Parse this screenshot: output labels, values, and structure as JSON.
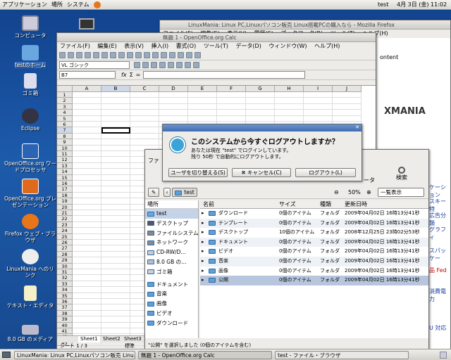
{
  "topbar": {
    "menus": [
      "アプリケーション",
      "場所",
      "システム"
    ],
    "user": "test",
    "date": "4月 3日 (金) 11:02"
  },
  "desktop_icons": [
    {
      "label": "コンピュータ",
      "name": "computer"
    },
    {
      "label": "testのホーム",
      "name": "home"
    },
    {
      "label": "ゴミ箱",
      "name": "trash"
    },
    {
      "label": "Eclipse",
      "name": "eclipse"
    },
    {
      "label": "OpenOffice.org ワードプロセッサ",
      "name": "writer"
    },
    {
      "label": "OpenOffice.org プレゼンテーション",
      "name": "impress"
    },
    {
      "label": "Firefox ウェブ・ブラウザ",
      "name": "firefox"
    },
    {
      "label": "LinuxMania へのリンク",
      "name": "linuxmania-link"
    },
    {
      "label": "テキスト・エディタ",
      "name": "text-editor"
    },
    {
      "label": "8.0 GB のメディア",
      "name": "media"
    }
  ],
  "firefox": {
    "title": "LinuxMania: Linux PC,Linuxパソコン販売 Linux搭載PCの購入なら - Mozilla Firefox",
    "menu": [
      "ファイル(F)",
      "編集(E)",
      "表示(V)",
      "履歴(S)",
      "ブックマーク(B)",
      "ツール(T)",
      "ヘルプ(H)"
    ],
    "snippets": [
      "ontent",
      "ケーション",
      "スキー特",
      "広告分類",
      "グラフィ",
      "スパッケー",
      "品 Fed",
      "消費電力",
      "U 対応"
    ]
  },
  "calc": {
    "title": "無題 1 - OpenOffice.org Calc",
    "menu": [
      "ファイル(F)",
      "編集(E)",
      "表示(V)",
      "挿入(I)",
      "書式(O)",
      "ツール(T)",
      "データ(D)",
      "ウィンドウ(W)",
      "ヘルプ(H)"
    ],
    "font": "VL ゴシック",
    "cellref": "B7",
    "columns": [
      "A",
      "B",
      "C",
      "D",
      "E",
      "F",
      "G",
      "H",
      "I",
      "J"
    ],
    "rows": [
      "1",
      "2",
      "3",
      "4",
      "5",
      "6",
      "7",
      "8",
      "9",
      "10",
      "11",
      "12",
      "13",
      "14",
      "15",
      "16",
      "17",
      "18",
      "19",
      "20",
      "21",
      "22",
      "23",
      "24",
      "25",
      "26",
      "27",
      "28",
      "29",
      "30",
      "31",
      "32",
      "33",
      "34",
      "35",
      "36",
      "37",
      "38",
      "39",
      "40",
      "41",
      "42",
      "43"
    ],
    "sheets": [
      "Sheet1",
      "Sheet2",
      "Sheet3"
    ],
    "status": "シート 1 / 3",
    "status2": "標準"
  },
  "dialog": {
    "heading": "このシステムから今すぐログアウトしますか？",
    "line1": "あなたは現在 \"test\" でログインしています。",
    "line2": "残り 50秒 で自動的にログアウトします。",
    "switch_label": "ユーザを切り替える(S)",
    "cancel_label": "キャンセル(C)",
    "logout_label": "ログアウト(L)"
  },
  "files": {
    "location": "test",
    "zoom": "50%",
    "view": "一覧表示",
    "places_header": "場所",
    "places": [
      "test",
      "デスクトップ",
      "ファイルシステム",
      "ネットワーク",
      "CD-RW/D…",
      "8.0 GB の…",
      "ゴミ箱",
      "ドキュメント",
      "音楽",
      "画像",
      "ビデオ",
      "ダウンロード"
    ],
    "columns": [
      "名前",
      "サイズ",
      "種類",
      "更新日時"
    ],
    "items": [
      {
        "name": "ダウンロード",
        "size": "0個のアイテム",
        "type": "フォルダ",
        "date": "2009年04月02日 16時13分41秒"
      },
      {
        "name": "テンプレート",
        "size": "0個のアイテム",
        "type": "フォルダ",
        "date": "2009年04月02日 16時13分41秒"
      },
      {
        "name": "デスクトップ",
        "size": "10個のアイテム",
        "type": "フォルダ",
        "date": "2008年12月25日 23時02分53秒"
      },
      {
        "name": "ドキュメント",
        "size": "0個のアイテム",
        "type": "フォルダ",
        "date": "2009年04月02日 16時13分41秒"
      },
      {
        "name": "ビデオ",
        "size": "0個のアイテム",
        "type": "フォルダ",
        "date": "2009年04月02日 16時13分41秒"
      },
      {
        "name": "音楽",
        "size": "0個のアイテム",
        "type": "フォルダ",
        "date": "2009年04月02日 16時13分41秒"
      },
      {
        "name": "画像",
        "size": "0個のアイテム",
        "type": "フォルダ",
        "date": "2009年04月02日 16時13分41秒"
      },
      {
        "name": "公開",
        "size": "0個のアイテム",
        "type": "フォルダ",
        "date": "2009年04月02日 16時13分41秒"
      }
    ],
    "status": "\"公開\" を選択しました (0個のアイテムを含む)",
    "search": "検索",
    "computer": "ータ",
    "fa": "ファ"
  },
  "taskbar": {
    "tasks": [
      "LinuxMania: Linux PC,Linuxパソコン販売 Linu…",
      "無題 1 - OpenOffice.org Calc",
      "test - ファイル・ブラウザ"
    ]
  }
}
